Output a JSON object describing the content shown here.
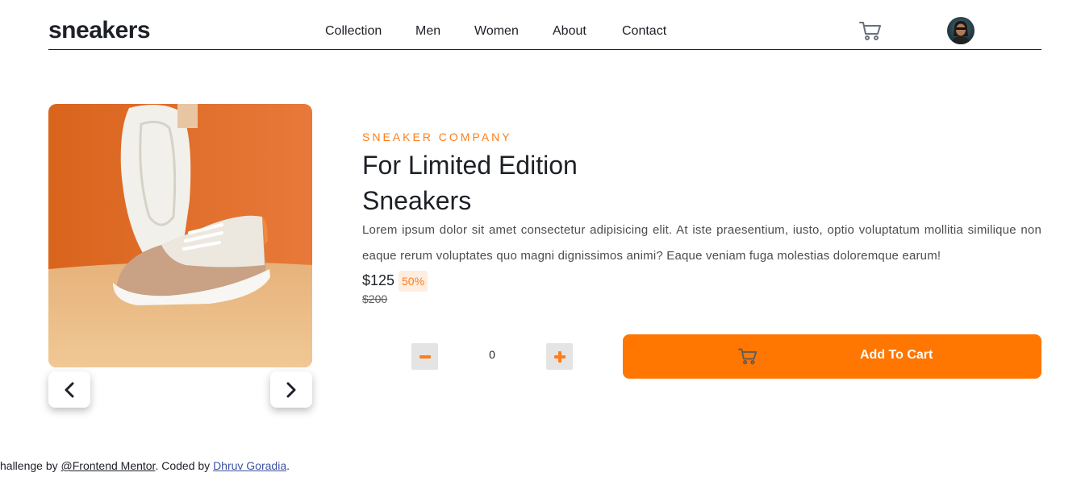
{
  "header": {
    "logo": "sneakers",
    "nav": [
      "Collection",
      "Men",
      "Women",
      "About",
      "Contact"
    ]
  },
  "product": {
    "company": "SNEAKER COMPANY",
    "title_line1": "For Limited Edition",
    "title_line2": "Sneakers",
    "description": "Lorem ipsum dolor sit amet consectetur adipisicing elit. At iste praesentium, iusto, optio voluptatum mollitia similique non eaque rerum voluptates quo magni dignissimos animi? Eaque veniam fuga molestias doloremque earum!",
    "price": "$125",
    "discount": "50%",
    "old_price": "$200",
    "quantity": "0",
    "add_to_cart": "Add To Cart"
  },
  "footer": {
    "prefix": "hallenge by ",
    "fm_link": "@Frontend Mentor",
    "middle": ". Coded by ",
    "author_link": "Dhruv Goradia",
    "suffix": "."
  },
  "colors": {
    "accent": "#ff7600",
    "accent_text": "#ff7d1a",
    "discount_bg": "#ffede0",
    "dark": "#1d2026"
  },
  "icons": {
    "cart": "cart-icon",
    "prev": "chevron-left-icon",
    "next": "chevron-right-icon",
    "minus": "minus-icon",
    "plus": "plus-icon"
  }
}
